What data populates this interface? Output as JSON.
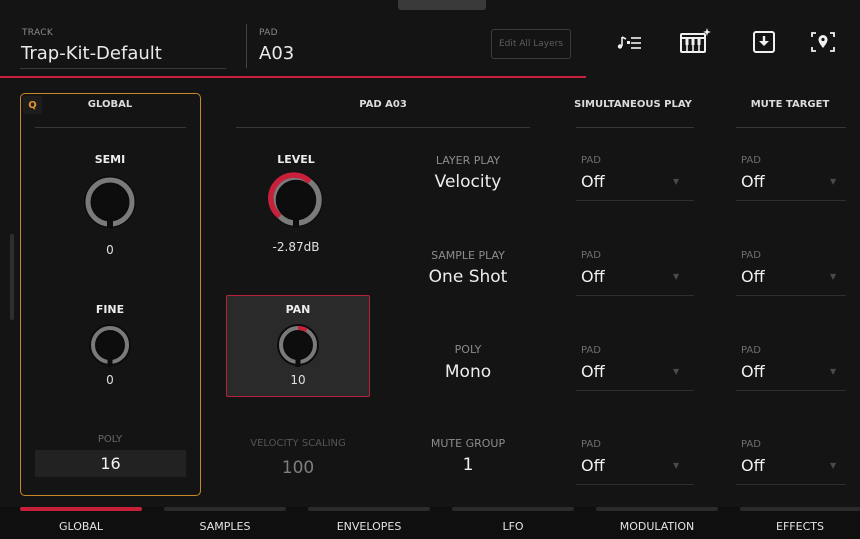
{
  "header": {
    "track_label": "TRACK",
    "track_value": "Trap-Kit-Default",
    "pad_label": "PAD",
    "pad_value": "A03",
    "edit_all_layers": "Edit All Layers",
    "icons": [
      "note-list-icon",
      "keyboard-sparkle-icon",
      "download-icon",
      "locate-icon"
    ]
  },
  "global": {
    "badge": "Q",
    "title": "GLOBAL",
    "semi_label": "SEMI",
    "semi_value": "0",
    "fine_label": "FINE",
    "fine_value": "0",
    "poly_label": "POLY",
    "poly_value": "16"
  },
  "pad_section": {
    "title": "PAD A03",
    "level_label": "LEVEL",
    "level_value": "-2.87dB",
    "pan_label": "PAN",
    "pan_value": "10",
    "velocity_scaling_label": "VELOCITY SCALING",
    "velocity_scaling_value": "100",
    "layer_play_label": "LAYER PLAY",
    "layer_play_value": "Velocity",
    "sample_play_label": "SAMPLE PLAY",
    "sample_play_value": "One Shot",
    "poly_label": "POLY",
    "poly_value": "Mono",
    "mute_group_label": "MUTE GROUP",
    "mute_group_value": "1"
  },
  "simultaneous_play": {
    "title": "SIMULTANEOUS PLAY",
    "rows": [
      {
        "label": "PAD",
        "value": "Off"
      },
      {
        "label": "PAD",
        "value": "Off"
      },
      {
        "label": "PAD",
        "value": "Off"
      },
      {
        "label": "PAD",
        "value": "Off"
      }
    ]
  },
  "mute_target": {
    "title": "MUTE TARGET",
    "rows": [
      {
        "label": "PAD",
        "value": "Off"
      },
      {
        "label": "PAD",
        "value": "Off"
      },
      {
        "label": "PAD",
        "value": "Off"
      },
      {
        "label": "PAD",
        "value": "Off"
      }
    ]
  },
  "tabs": [
    {
      "label": "GLOBAL",
      "active": true
    },
    {
      "label": "SAMPLES",
      "active": false
    },
    {
      "label": "ENVELOPES",
      "active": false
    },
    {
      "label": "LFO",
      "active": false
    },
    {
      "label": "MODULATION",
      "active": false
    },
    {
      "label": "EFFECTS",
      "active": false
    }
  ],
  "colors": {
    "accent_red": "#c8203a",
    "focus_orange": "#c8882a",
    "background": "#141414"
  }
}
